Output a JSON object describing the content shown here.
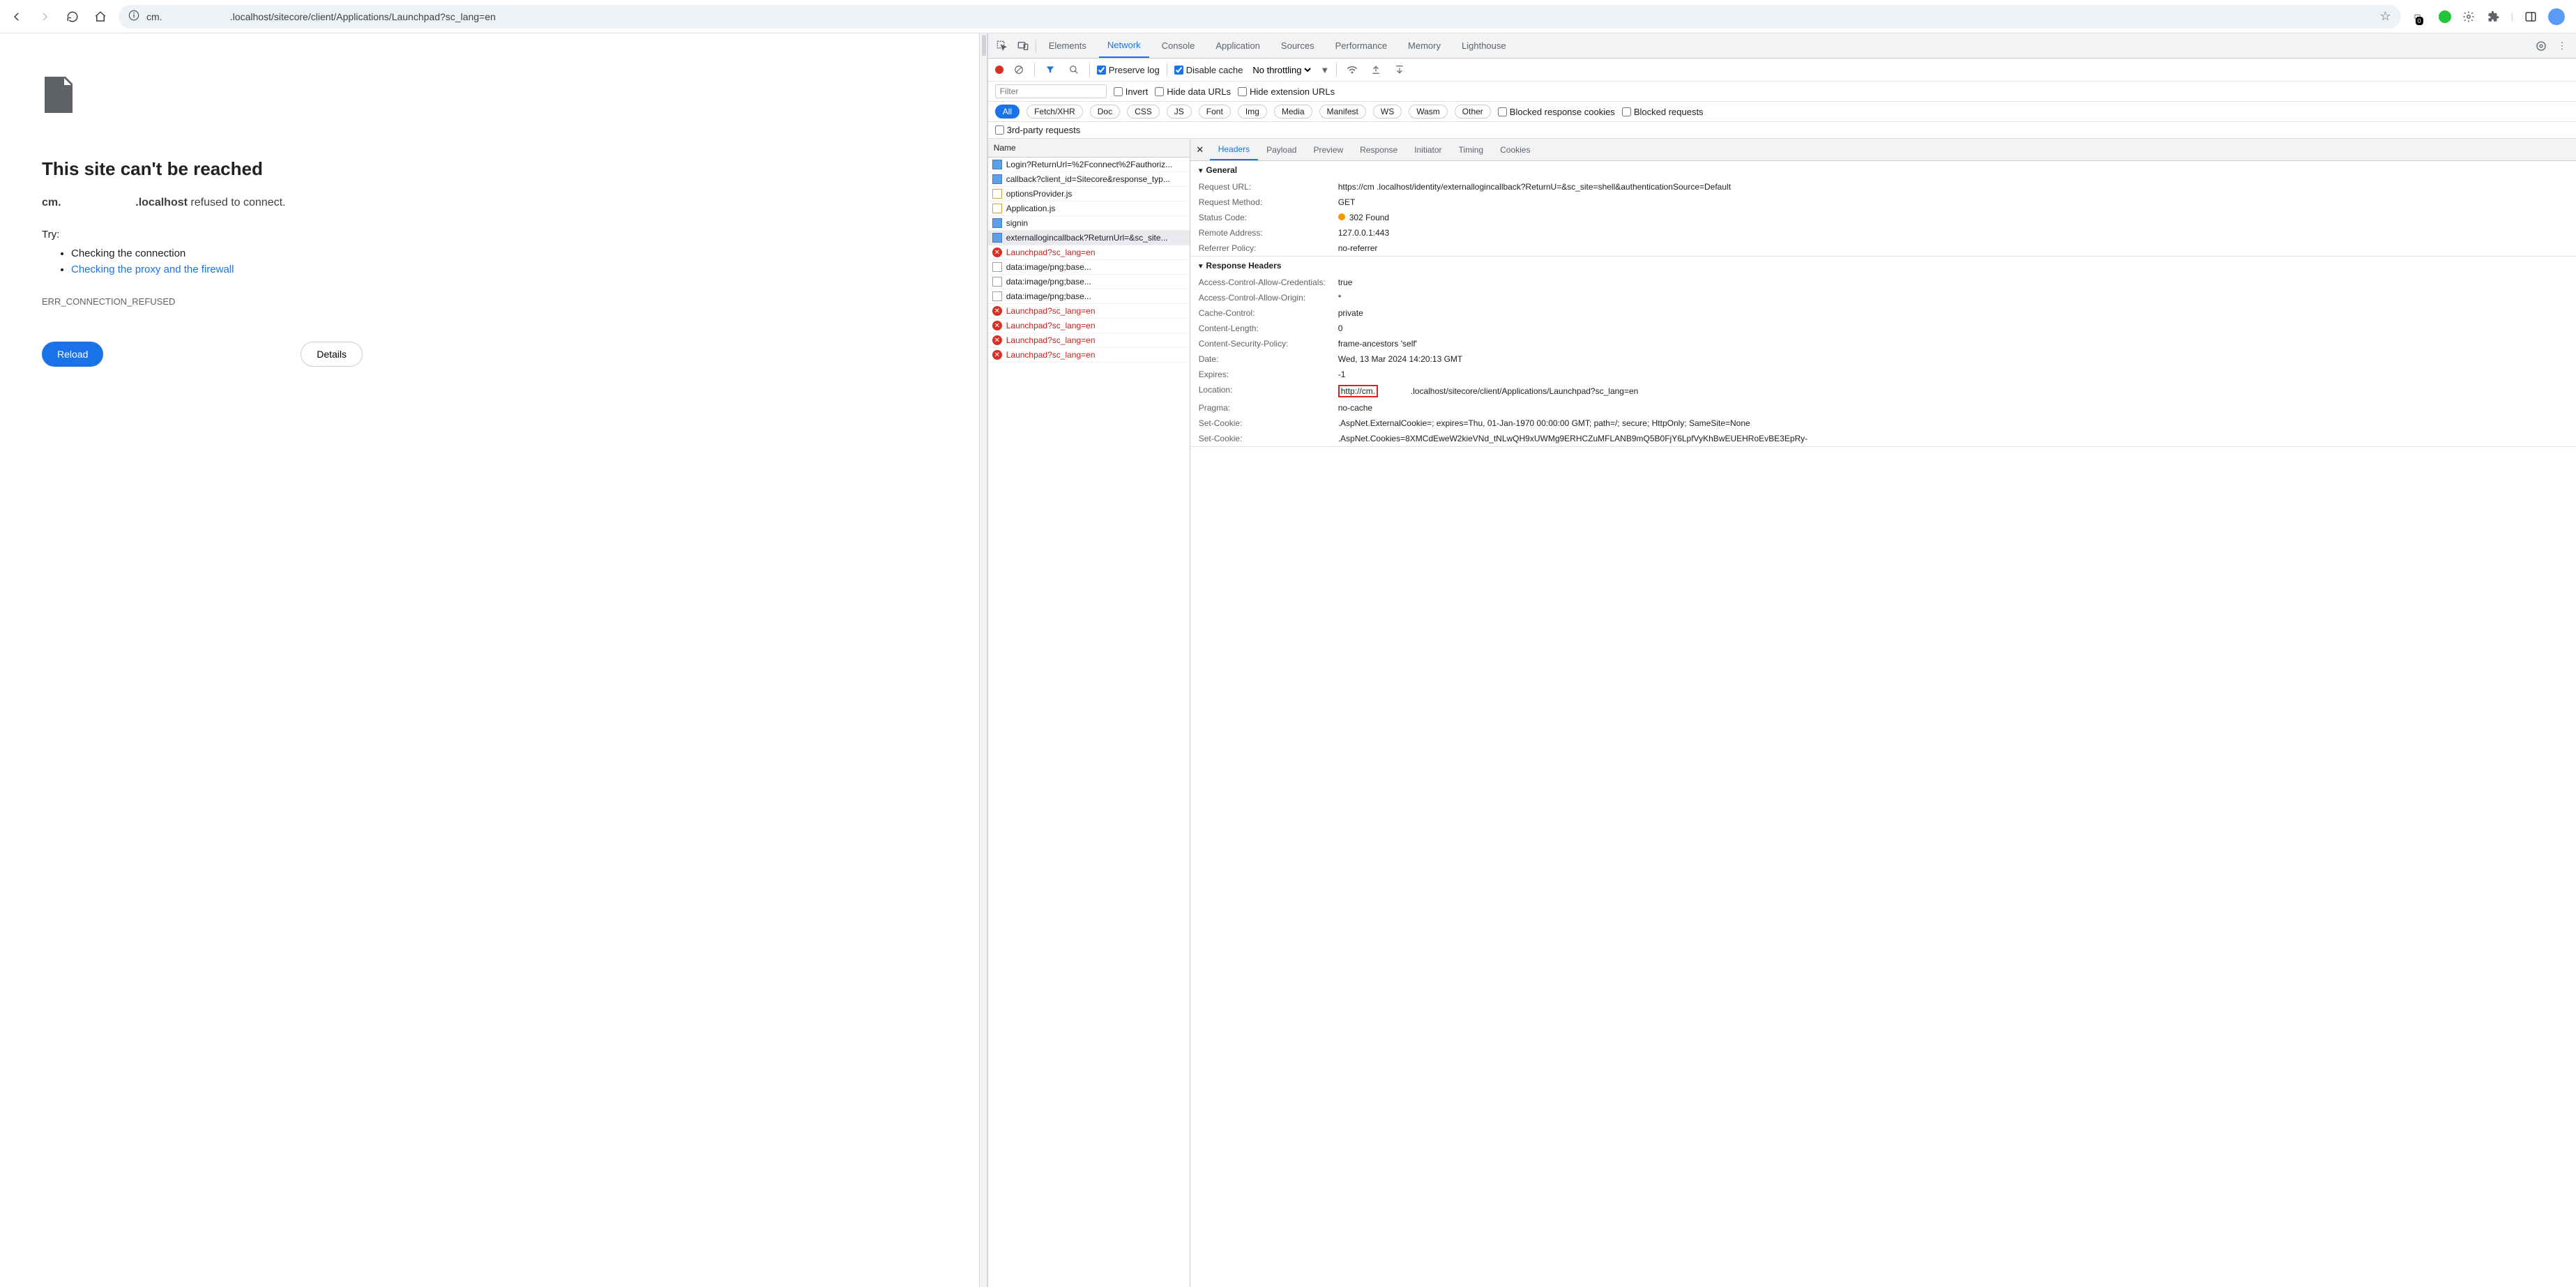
{
  "browser": {
    "url_display": "cm.                         .localhost/sitecore/client/Applications/Launchpad?sc_lang=en",
    "ext_badge": "0"
  },
  "error_page": {
    "title": "This site can't be reached",
    "host_prefix": "cm.",
    "host_suffix": ".localhost",
    "refused": " refused to connect.",
    "try_label": "Try:",
    "check_conn": "Checking the connection",
    "check_proxy": "Checking the proxy and the firewall",
    "err_code": "ERR_CONNECTION_REFUSED",
    "reload": "Reload",
    "details": "Details"
  },
  "devtools": {
    "tabs": {
      "elements": "Elements",
      "network": "Network",
      "console": "Console",
      "application": "Application",
      "sources": "Sources",
      "performance": "Performance",
      "memory": "Memory",
      "lighthouse": "Lighthouse"
    },
    "toolbar": {
      "preserve_log": "Preserve log",
      "disable_cache": "Disable cache",
      "throttling": "No throttling"
    },
    "filter_row": {
      "filter_ph": "Filter",
      "invert": "Invert",
      "hide_data": "Hide data URLs",
      "hide_ext": "Hide extension URLs"
    },
    "chips": {
      "all": "All",
      "fetch": "Fetch/XHR",
      "doc": "Doc",
      "css": "CSS",
      "js": "JS",
      "font": "Font",
      "img": "Img",
      "media": "Media",
      "manifest": "Manifest",
      "ws": "WS",
      "wasm": "Wasm",
      "other": "Other",
      "blocked_cookies": "Blocked response cookies",
      "blocked_req": "Blocked requests",
      "third_party": "3rd-party requests"
    },
    "net_header": "Name",
    "requests": [
      {
        "type": "doc",
        "label": "Login?ReturnUrl=%2Fconnect%2Fauthoriz...",
        "err": false
      },
      {
        "type": "doc",
        "label": "callback?client_id=Sitecore&response_typ...",
        "err": false
      },
      {
        "type": "js",
        "label": "optionsProvider.js",
        "err": false
      },
      {
        "type": "js",
        "label": "Application.js",
        "err": false
      },
      {
        "type": "doc",
        "label": "signin",
        "err": false
      },
      {
        "type": "doc",
        "label": "externallogincallback?ReturnUrl=&sc_site...",
        "err": false,
        "selected": true
      },
      {
        "type": "errx",
        "label": "Launchpad?sc_lang=en",
        "err": true
      },
      {
        "type": "other",
        "label": "data:image/png;base...",
        "err": false
      },
      {
        "type": "other",
        "label": "data:image/png;base...",
        "err": false
      },
      {
        "type": "other",
        "label": "data:image/png;base...",
        "err": false
      },
      {
        "type": "errx",
        "label": "Launchpad?sc_lang=en",
        "err": true
      },
      {
        "type": "errx",
        "label": "Launchpad?sc_lang=en",
        "err": true
      },
      {
        "type": "errx",
        "label": "Launchpad?sc_lang=en",
        "err": true
      },
      {
        "type": "errx",
        "label": "Launchpad?sc_lang=en",
        "err": true
      }
    ],
    "detail_tabs": {
      "headers": "Headers",
      "payload": "Payload",
      "preview": "Preview",
      "response": "Response",
      "initiator": "Initiator",
      "timing": "Timing",
      "cookies": "Cookies"
    },
    "general_label": "General",
    "general": {
      "req_url_k": "Request URL:",
      "req_url_v": "https://cm                          .localhost/identity/externallogincallback?ReturnU=&sc_site=shell&authenticationSource=Default",
      "method_k": "Request Method:",
      "method_v": "GET",
      "status_k": "Status Code:",
      "status_v": "302 Found",
      "remote_k": "Remote Address:",
      "remote_v": "127.0.0.1:443",
      "ref_k": "Referrer Policy:",
      "ref_v": "no-referrer"
    },
    "resp_label": "Response Headers",
    "resp": {
      "acac_k": "Access-Control-Allow-Credentials:",
      "acac_v": "true",
      "acao_k": "Access-Control-Allow-Origin:",
      "acao_v": "*",
      "cc_k": "Cache-Control:",
      "cc_v": "private",
      "cl_k": "Content-Length:",
      "cl_v": "0",
      "csp_k": "Content-Security-Policy:",
      "csp_v": "frame-ancestors 'self'",
      "date_k": "Date:",
      "date_v": "Wed, 13 Mar 2024 14:20:13 GMT",
      "exp_k": "Expires:",
      "exp_v": "-1",
      "loc_k": "Location:",
      "loc_hl": "http://cm.",
      "loc_rest": ".localhost/sitecore/client/Applications/Launchpad?sc_lang=en",
      "prag_k": "Pragma:",
      "prag_v": "no-cache",
      "sc1_k": "Set-Cookie:",
      "sc1_v": ".AspNet.ExternalCookie=; expires=Thu, 01-Jan-1970 00:00:00 GMT; path=/; secure; HttpOnly; SameSite=None",
      "sc2_k": "Set-Cookie:",
      "sc2_v": ".AspNet.Cookies=8XMCdEweW2kieVNd_tNLwQH9xUWMg9ERHCZuMFLANB9mQ5B0FjY6LpfVyKhBwEUEHRoEvBE3EpRy-"
    }
  }
}
